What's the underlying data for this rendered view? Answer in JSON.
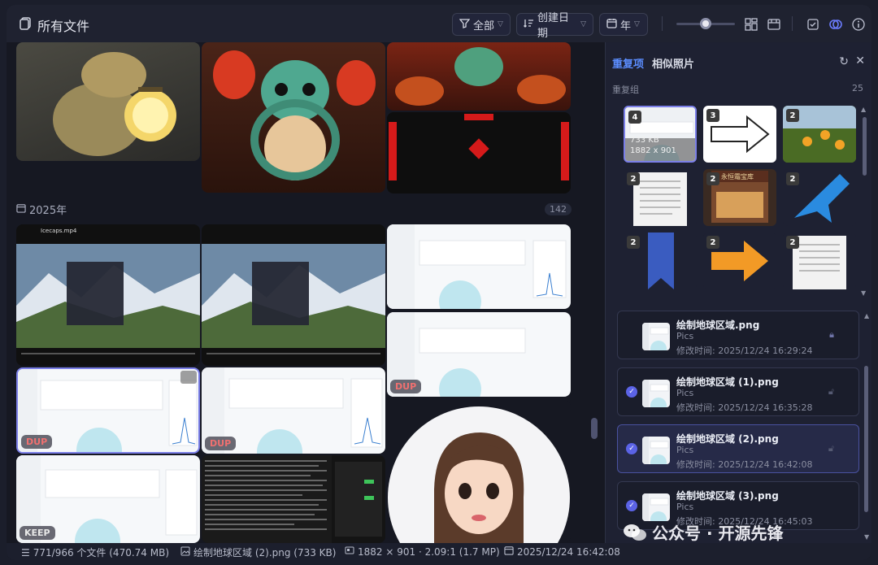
{
  "header": {
    "title": "所有文件",
    "filter_label": "全部",
    "sort_label": "创建日期",
    "group_label": "年"
  },
  "gallery": {
    "year_label": "2025年",
    "year_count": "142",
    "badges": [
      "DUP",
      "DUP",
      "DUP",
      "KEEP"
    ],
    "video_title": "Icecaps.mp4"
  },
  "panel": {
    "tab_duplicates": "重复项",
    "tab_similar": "相似照片",
    "group_label": "重复组",
    "group_count": "25",
    "groups": [
      {
        "count": "4",
        "size": "733 KB",
        "dims": "1882 x 901"
      },
      {
        "count": "3"
      },
      {
        "count": "2"
      },
      {
        "count": "2"
      },
      {
        "count": "2",
        "sign": "永恒霜宝库"
      },
      {
        "count": "2"
      },
      {
        "count": "2"
      },
      {
        "count": "2"
      },
      {
        "count": "2"
      }
    ],
    "files": [
      {
        "name": "绘制地球区域.png",
        "category": "Pics",
        "modified": "修改时间: 2025/12/24 16:29:24",
        "checked": false,
        "selected": false
      },
      {
        "name": "绘制地球区域 (1).png",
        "category": "Pics",
        "modified": "修改时间: 2025/12/24 16:35:28",
        "checked": true,
        "selected": false
      },
      {
        "name": "绘制地球区域 (2).png",
        "category": "Pics",
        "modified": "修改时间: 2025/12/24 16:42:08",
        "checked": true,
        "selected": true
      },
      {
        "name": "绘制地球区域 (3).png",
        "category": "Pics",
        "modified": "修改时间: 2025/12/24 16:45:03",
        "checked": true,
        "selected": false
      }
    ]
  },
  "status": {
    "count": "771/966 个文件 (470.74 MB)",
    "file": "绘制地球区域 (2).png (733 KB)",
    "dims": "1882 × 901 · 2.09:1 (1.7 MP)",
    "date": "2025/12/24 16:42:08"
  },
  "watermark": "公众号 · 开源先锋",
  "colors": {
    "accent": "#5b8dff",
    "dup": "#f07070",
    "selected": "#5b63e6"
  }
}
